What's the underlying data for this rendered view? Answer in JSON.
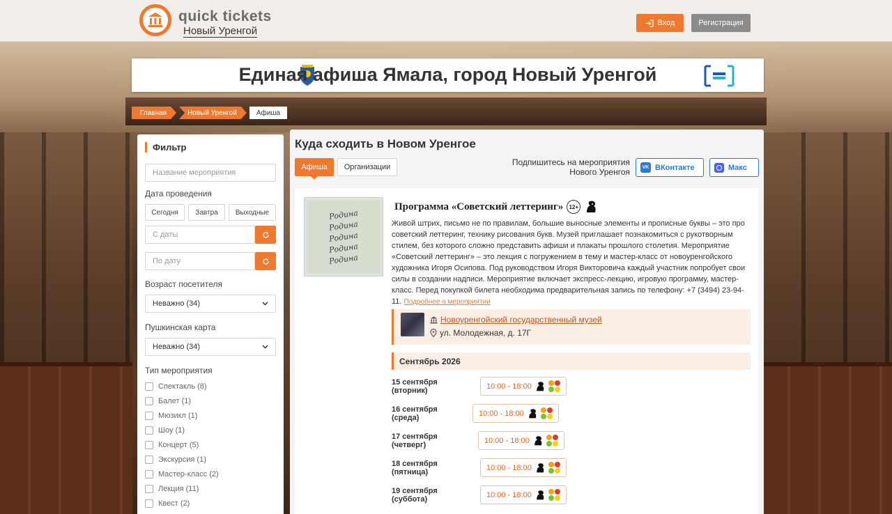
{
  "header": {
    "logo_title": "quick tickets",
    "logo_city": "Новый Уренгой",
    "login_label": "Вход",
    "register_label": "Регистрация"
  },
  "banner": {
    "title": "Единая афиша Ямала, город Новый Уренгой"
  },
  "breadcrumbs": [
    "Главная",
    "Новый Уренгой",
    "Афиша"
  ],
  "filter": {
    "title": "Фильтр",
    "name_placeholder": "Название мероприятия",
    "date_label": "Дата проведения",
    "quick_dates": [
      "Сегодня",
      "Завтра",
      "Выходные"
    ],
    "from_placeholder": "С даты",
    "to_placeholder": "По дату",
    "age_label": "Возраст посетителя",
    "age_value": "Неважно (34)",
    "pushkin_label": "Пушкинская карта",
    "pushkin_value": "Неважно (34)",
    "type_label": "Тип мероприятия",
    "types": [
      "Спектакль (8)",
      "Балет (1)",
      "Мюзикл (1)",
      "Шоу (1)",
      "Концерт (5)",
      "Экскурсия (1)",
      "Мастер-класс (2)",
      "Лекция (11)",
      "Квест (2)"
    ]
  },
  "main": {
    "title": "Куда сходить в Новом Уренгое",
    "tab_afisha": "Афиша",
    "tab_orgs": "Организации",
    "subscribe_text": "Подпишитесь на мероприятия Нового Уренгоя",
    "vk_label": "ВКонтакте",
    "max_label": "Макс"
  },
  "event": {
    "title": "Программа «Советский леттеринг»",
    "age": "12+",
    "poster_words": [
      "Родина",
      "Родина",
      "Родина",
      "Родина",
      "Родина"
    ],
    "description": "Живой штрих, письмо не по правилам, большие выносные элементы и прописные буквы – это про советский леттеринг, технику рисования букв. Музей приглашает познакомиться с рукотворным стилем, без которого сложно представить афиши и плакаты прошлого столетия. Мероприятие «Советский леттеринг» – это лекция с погружением в тему и мастер-класс от новоуренгойского художника Игоря Осипова. Под руководством Игоря Викторовича каждый участник попробует свои силы в создании надписи. Мероприятие включает экспресс-лекцию, игровую программу, мастер-класс. Перед покупкой билета необходима предварительная запись по телефону: +7 (3494) 23-94-11.",
    "more_link": "Подробнее о мероприятии",
    "venue_name": "Новоуренгойский государственный музей",
    "venue_address": "ул. Молодежная, д. 17Г",
    "month": "Сентябрь 2026",
    "dates": [
      {
        "label": "15 сентября (вторник)",
        "time": "10:00 - 18:00"
      },
      {
        "label": "16 сентября (среда)",
        "time": "10:00 - 18:00"
      },
      {
        "label": "17 сентября (четверг)",
        "time": "10:00 - 18:00"
      },
      {
        "label": "18 сентября (пятница)",
        "time": "10:00 - 18:00"
      },
      {
        "label": "19 сентября (суббота)",
        "time": "10:00 - 18:00"
      }
    ]
  },
  "colors": {
    "accent": "#ef7a2f",
    "link_blue": "#2a79d6"
  }
}
